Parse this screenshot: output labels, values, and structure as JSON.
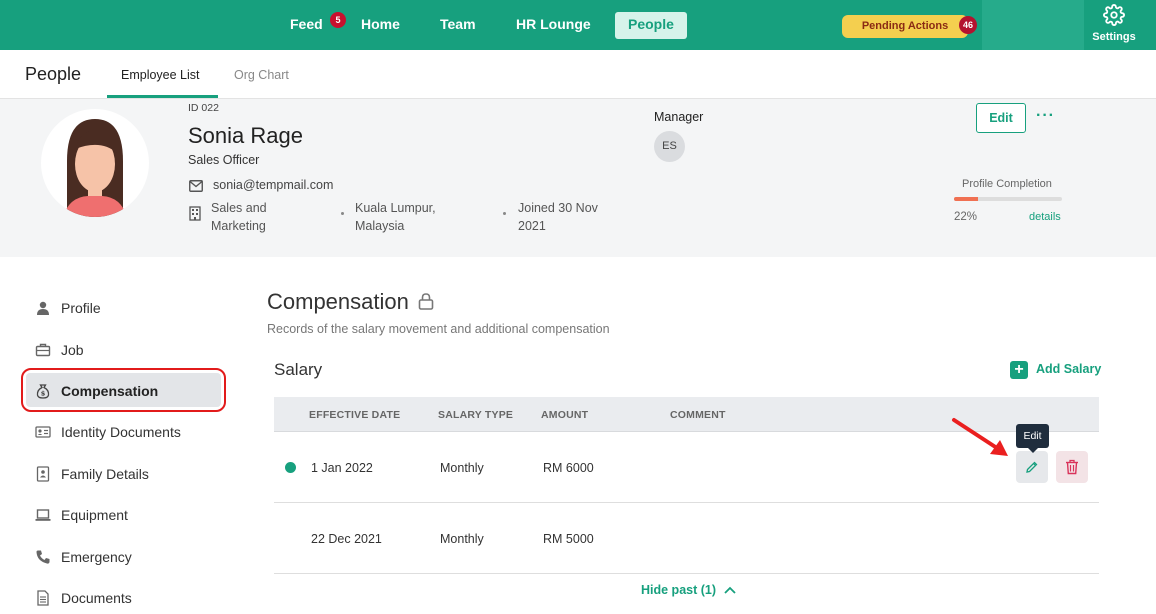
{
  "nav": {
    "items": [
      {
        "label": "Feed",
        "badge": "5"
      },
      {
        "label": "Home"
      },
      {
        "label": "Team"
      },
      {
        "label": "HR Lounge"
      },
      {
        "label": "People",
        "active": true
      }
    ],
    "pending_actions": {
      "label": "Pending Actions",
      "count": "46"
    },
    "settings_label": "Settings"
  },
  "subheader": {
    "title": "People",
    "tabs": [
      {
        "label": "Employee List",
        "active": true
      },
      {
        "label": "Org Chart"
      }
    ]
  },
  "profile": {
    "id": "ID 022",
    "name": "Sonia Rage",
    "role": "Sales Officer",
    "email": "sonia@tempmail.com",
    "department": "Sales and Marketing",
    "location": "Kuala Lumpur, Malaysia",
    "joined": "Joined 30 Nov 2021",
    "manager_label": "Manager",
    "manager_initials": "ES",
    "edit_label": "Edit",
    "more_label": "···",
    "completion_label": "Profile Completion",
    "completion_percent": "22%",
    "completion_value": 0.22,
    "details_label": "details"
  },
  "sidebar": {
    "items": [
      {
        "label": "Profile",
        "icon": "person-icon"
      },
      {
        "label": "Job",
        "icon": "briefcase-icon"
      },
      {
        "label": "Compensation",
        "icon": "money-bag-icon",
        "active": true
      },
      {
        "label": "Identity Documents",
        "icon": "id-card-icon"
      },
      {
        "label": "Family Details",
        "icon": "family-icon"
      },
      {
        "label": "Equipment",
        "icon": "laptop-icon"
      },
      {
        "label": "Emergency",
        "icon": "phone-icon"
      },
      {
        "label": "Documents",
        "icon": "document-icon"
      }
    ]
  },
  "compensation": {
    "title": "Compensation",
    "subtitle": "Records of the salary movement and additional compensation",
    "salary_heading": "Salary",
    "add_salary_label": "Add Salary",
    "columns": [
      "EFFECTIVE DATE",
      "SALARY TYPE",
      "AMOUNT",
      "COMMENT"
    ],
    "rows": [
      {
        "date": "1 Jan 2022",
        "type": "Monthly",
        "amount": "RM 6000",
        "comment": "",
        "current": true
      },
      {
        "date": "22 Dec 2021",
        "type": "Monthly",
        "amount": "RM 5000",
        "comment": "",
        "current": false
      }
    ],
    "tooltip": "Edit",
    "hide_past_label": "Hide past (1)"
  },
  "colors": {
    "brand": "#17a07e",
    "badge": "#c8102e",
    "pending": "#f4cf4f",
    "highlight": "#e21b1b"
  }
}
